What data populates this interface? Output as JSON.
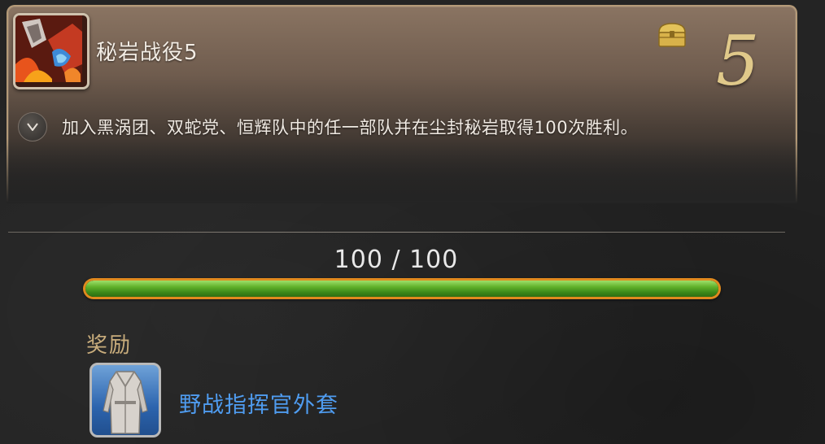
{
  "achievement": {
    "title": "秘岩战役5",
    "points": "5",
    "description": "加入黑涡团、双蛇党、恒辉队中的任一部队并在尘封秘岩取得100次胜利。"
  },
  "progress": {
    "text": "100 / 100",
    "fraction": 1.0
  },
  "reward": {
    "label": "奖励",
    "item_name": "野战指挥官外套"
  },
  "icons": {
    "achievement": "pvp-battle-icon",
    "chest": "treasure-chest-icon",
    "toggle": "chevron-down-icon",
    "reward": "coat-icon"
  },
  "colors": {
    "progress_fill": "#5fb02a",
    "progress_border": "#e08a1e",
    "reward_name": "#4f9cf0",
    "points": "#e0c98a"
  }
}
